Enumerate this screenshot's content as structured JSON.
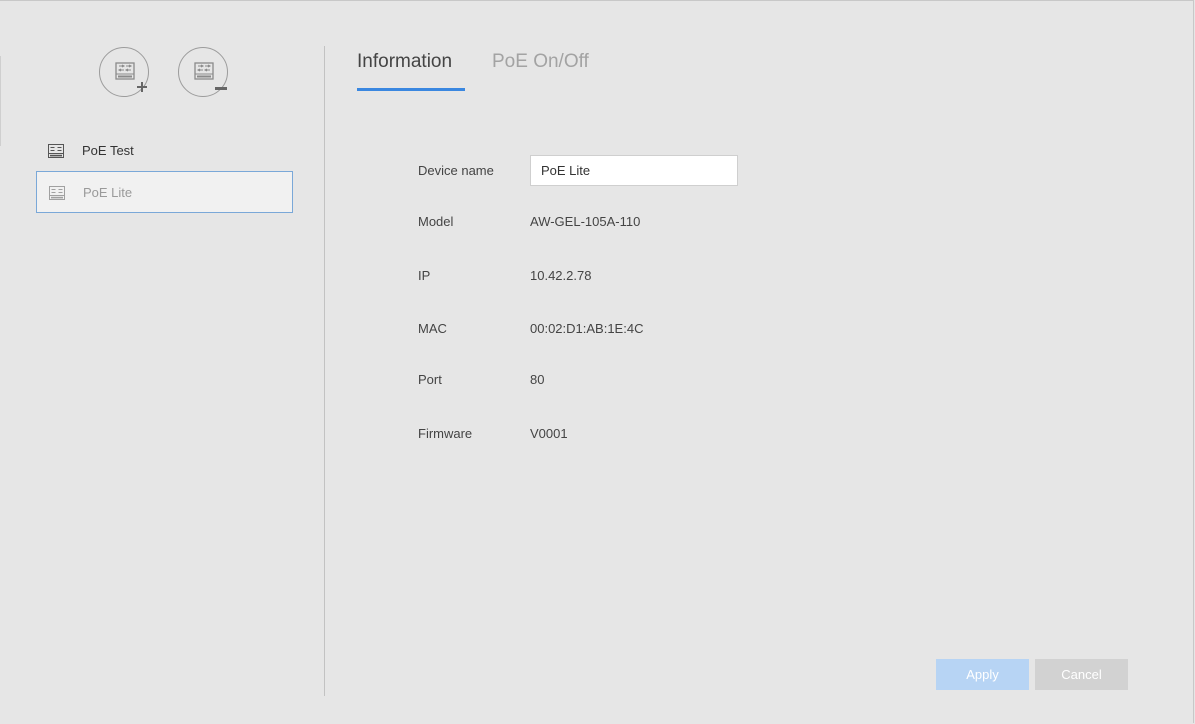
{
  "sidebar": {
    "add_button_icon": "add-switch-icon",
    "remove_button_icon": "remove-switch-icon",
    "devices": [
      {
        "label": "PoE Test",
        "icon": "switch-icon",
        "selected": false
      },
      {
        "label": "PoE Lite",
        "icon": "switch-icon",
        "selected": true
      }
    ]
  },
  "tabs": [
    {
      "label": "Information",
      "active": true
    },
    {
      "label": "PoE On/Off",
      "active": false
    }
  ],
  "info": {
    "device_name_label": "Device name",
    "device_name_value": "PoE Lite",
    "model_label": "Model",
    "model_value": "AW-GEL-105A-110",
    "ip_label": "IP",
    "ip_value": "10.42.2.78",
    "mac_label": "MAC",
    "mac_value": "00:02:D1:AB:1E:4C",
    "port_label": "Port",
    "port_value": "80",
    "firmware_label": "Firmware",
    "firmware_value": "V0001"
  },
  "actions": {
    "apply_label": "Apply",
    "cancel_label": "Cancel"
  },
  "colors": {
    "accent": "#3a87e0",
    "apply_disabled": "#b7d4f4",
    "cancel_disabled": "#d2d2d2",
    "background": "#e6e6e6"
  }
}
